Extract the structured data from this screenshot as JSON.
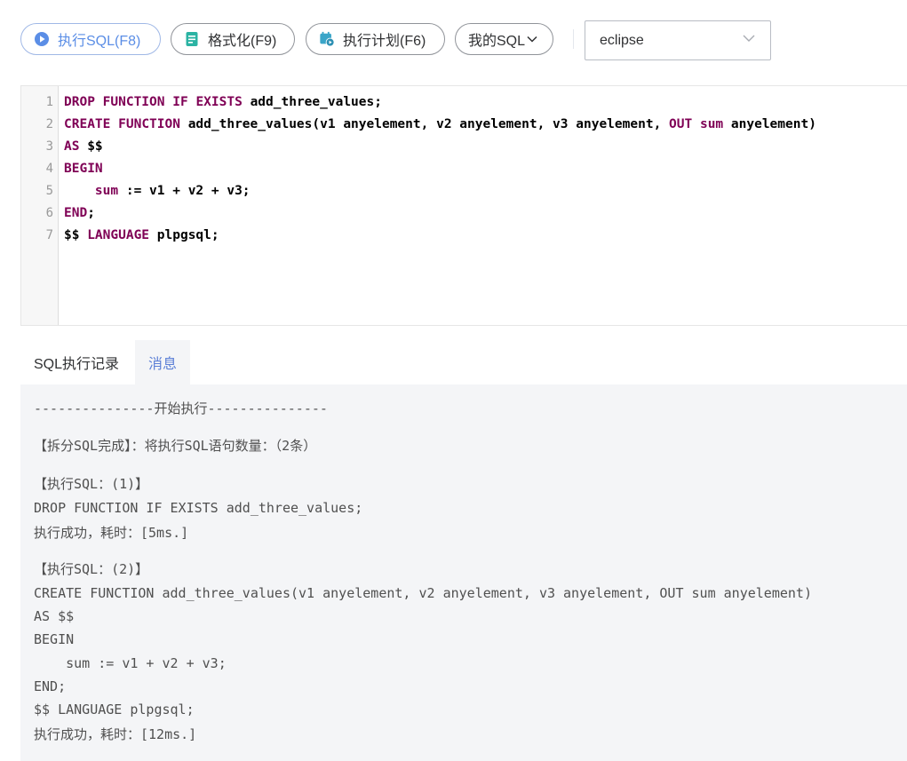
{
  "toolbar": {
    "run_label": "执行SQL(F8)",
    "format_label": "格式化(F9)",
    "plan_label": "执行计划(F6)",
    "my_sql_label": "我的SQL",
    "theme_value": "eclipse"
  },
  "editor": {
    "line_numbers": [
      "1",
      "2",
      "3",
      "4",
      "5",
      "6",
      "7"
    ]
  },
  "tabs": {
    "history": "SQL执行记录",
    "messages": "消息"
  },
  "messages": {
    "lines": [
      "---------------开始执行---------------",
      "【拆分SQL完成】：将执行SQL语句数量：（2条）",
      "【执行SQL：(1)】",
      "DROP FUNCTION IF EXISTS add_three_values;",
      "执行成功，耗时：[5ms.]",
      "【执行SQL：(2)】",
      "CREATE FUNCTION add_three_values(v1 anyelement, v2 anyelement, v3 anyelement, OUT sum anyelement)",
      "AS $$",
      "BEGIN",
      "    sum := v1 + v2 + v3;",
      "END;",
      "$$ LANGUAGE plpgsql;",
      "执行成功，耗时：[12ms.]"
    ]
  },
  "colors": {
    "keyword": "#7f0055",
    "accent": "#5b7fd6",
    "message_bg": "#f4f5f7"
  }
}
